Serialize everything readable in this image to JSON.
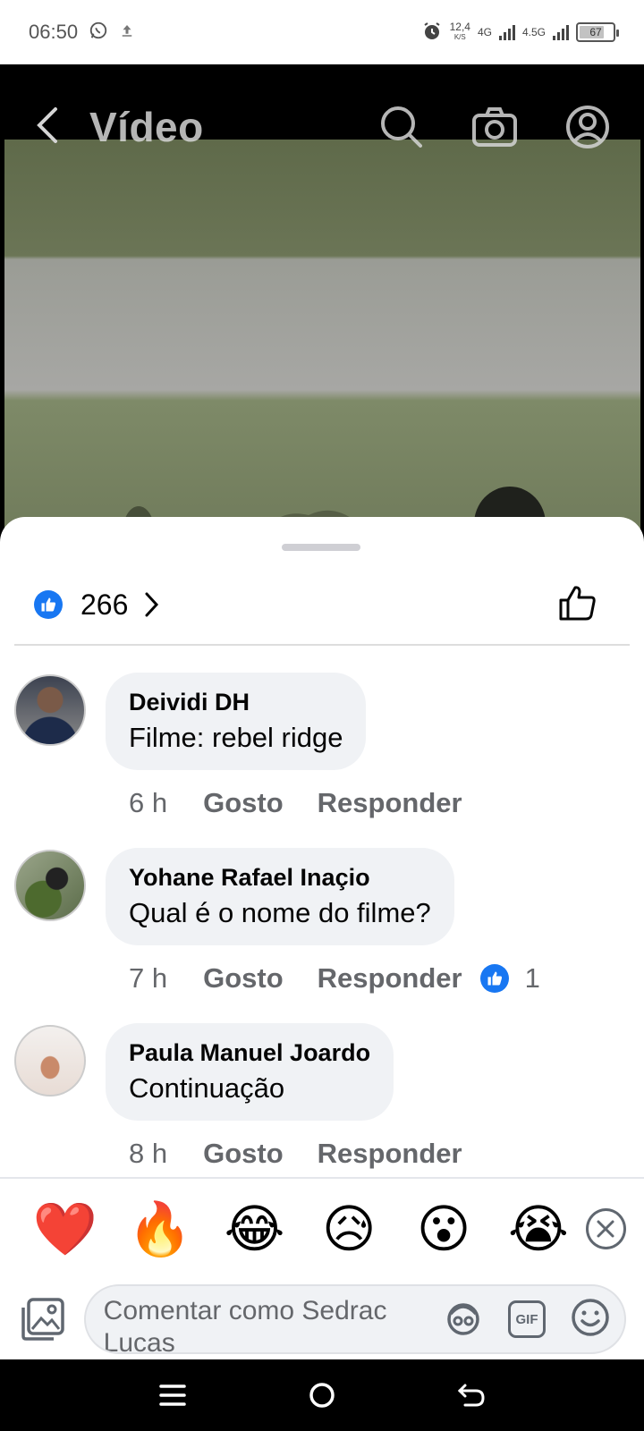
{
  "status_bar": {
    "time": "06:50",
    "net_speed": "12,4",
    "net_unit": "K/S",
    "net1": "4G",
    "net2": "4.5G",
    "battery": "67"
  },
  "header": {
    "title": "Vídeo"
  },
  "reactions": {
    "like_count": "266"
  },
  "comments": [
    {
      "author": "Deividi DH",
      "text": "Filme: rebel ridge",
      "time": "6 h",
      "like_label": "Gosto",
      "reply_label": "Responder",
      "reaction_count": ""
    },
    {
      "author": "Yohane Rafael Inaçio",
      "text": "Qual é o nome do filme?",
      "time": "7 h",
      "like_label": "Gosto",
      "reply_label": "Responder",
      "reaction_count": "1"
    },
    {
      "author": "Paula Manuel Joardo",
      "text": "Continuação",
      "time": "8 h",
      "like_label": "Gosto",
      "reply_label": "Responder",
      "reaction_count": ""
    }
  ],
  "emoji_bar": {
    "emojis": [
      "❤️",
      "🔥",
      "😂",
      "😥",
      "😮",
      "😭"
    ]
  },
  "composer": {
    "placeholder": "Comentar como Sedrac Lucas",
    "gif_label": "GIF"
  },
  "colors": {
    "accent": "#1877f2",
    "bubble": "#f0f2f5",
    "muted": "#65676b"
  }
}
